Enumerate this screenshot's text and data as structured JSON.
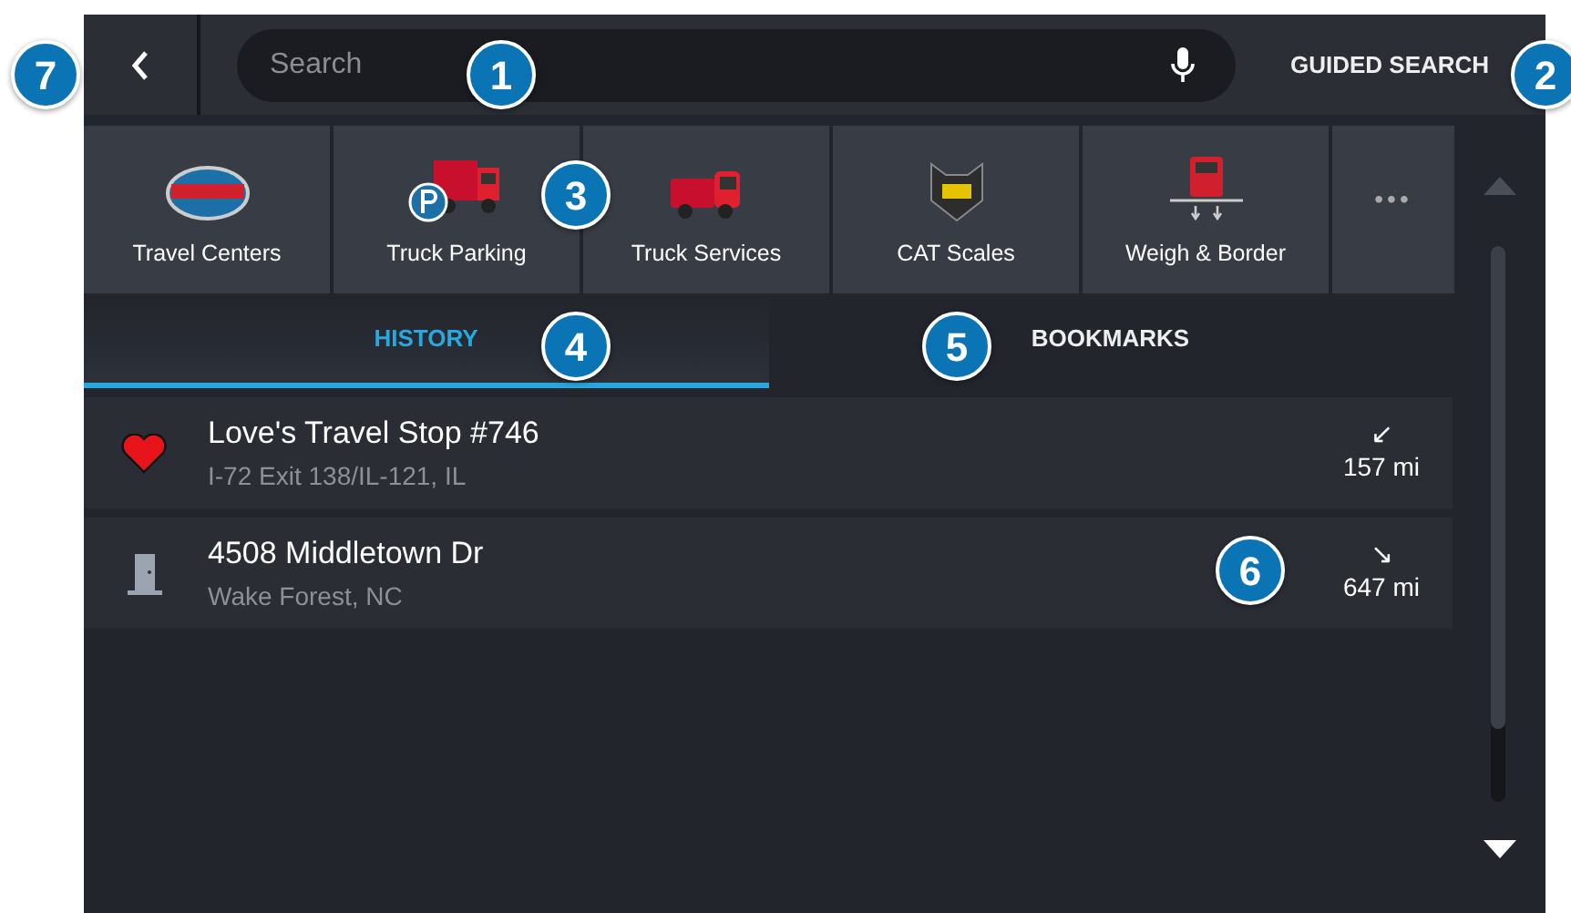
{
  "top_bar": {
    "search": {
      "placeholder": "Search"
    },
    "guided_search": "GUIDED SEARCH"
  },
  "categories": [
    {
      "kind": "travel-center",
      "label": "Travel Centers"
    },
    {
      "kind": "parking",
      "label": "Truck Parking"
    },
    {
      "kind": "service",
      "label": "Truck Services"
    },
    {
      "kind": "scales",
      "label": "CAT Scales"
    },
    {
      "kind": "border",
      "label": "Weigh & Border"
    },
    {
      "kind": "more",
      "label": "•••"
    }
  ],
  "tabs": [
    {
      "label": "HISTORY",
      "selected": true
    },
    {
      "label": "BOOKMARKS",
      "selected": false
    }
  ],
  "rows": [
    {
      "kind": "favorite",
      "title": "Love's Travel Stop #746",
      "subtitle": "I-72 Exit 138/IL-121, IL",
      "direction": "↙",
      "distance": "157 mi"
    },
    {
      "kind": "address",
      "title": "4508 Middletown Dr",
      "subtitle": "Wake Forest, NC",
      "direction": "↘",
      "distance": "647 mi"
    }
  ],
  "callouts": [
    "7",
    "1",
    "2",
    "3",
    "4",
    "5",
    "6"
  ]
}
